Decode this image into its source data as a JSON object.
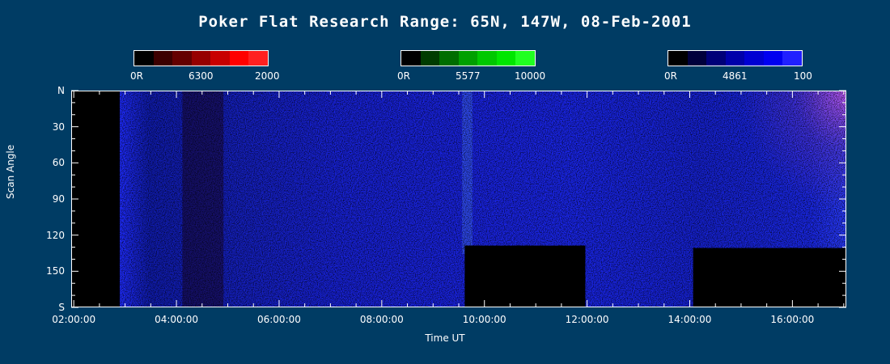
{
  "chart_data": {
    "type": "heatmap",
    "title": "Poker Flat Research Range: 65N, 147W, 08-Feb-2001",
    "xlabel": "Time UT",
    "ylabel": "Scan Angle",
    "x_ticks": [
      "02:00:00",
      "04:00:00",
      "06:00:00",
      "08:00:00",
      "10:00:00",
      "12:00:00",
      "14:00:00",
      "16:00:00"
    ],
    "x_tick_hours": [
      2,
      4,
      6,
      8,
      10,
      12,
      14,
      16
    ],
    "xlim": [
      1.95,
      17.05
    ],
    "y_ticks": [
      "N",
      "30",
      "60",
      "90",
      "120",
      "150",
      "S"
    ],
    "y_tick_values": [
      0,
      30,
      60,
      90,
      120,
      150,
      180
    ],
    "ylim": [
      0,
      180
    ],
    "colorbars": [
      {
        "min_label": "0R",
        "wavelength": "6300",
        "max_label": "2000",
        "colors": [
          "#000000",
          "#3c0000",
          "#640000",
          "#960000",
          "#c80000",
          "#ff0000",
          "#ff2020"
        ]
      },
      {
        "min_label": "0R",
        "wavelength": "5577",
        "max_label": "10000",
        "colors": [
          "#000000",
          "#003c00",
          "#006e00",
          "#00a000",
          "#00c800",
          "#00e600",
          "#20ff20"
        ]
      },
      {
        "min_label": "0R",
        "wavelength": "4861",
        "max_label": "100",
        "colors": [
          "#000000",
          "#00003c",
          "#000078",
          "#0000aa",
          "#0000d2",
          "#0000f0",
          "#2020ff"
        ]
      }
    ],
    "no_data_regions": [
      {
        "t_start": 1.95,
        "t_end": 2.88,
        "angle_start": 0,
        "angle_end": 180
      },
      {
        "t_start": 9.6,
        "t_end": 11.95,
        "angle_start": 128,
        "angle_end": 180
      },
      {
        "t_start": 14.05,
        "t_end": 17.05,
        "angle_start": 130,
        "angle_end": 180
      }
    ],
    "data_start_hour": 2.88,
    "colors": {
      "background": "#003c64",
      "dominant_emission": "#1a22ee"
    }
  }
}
